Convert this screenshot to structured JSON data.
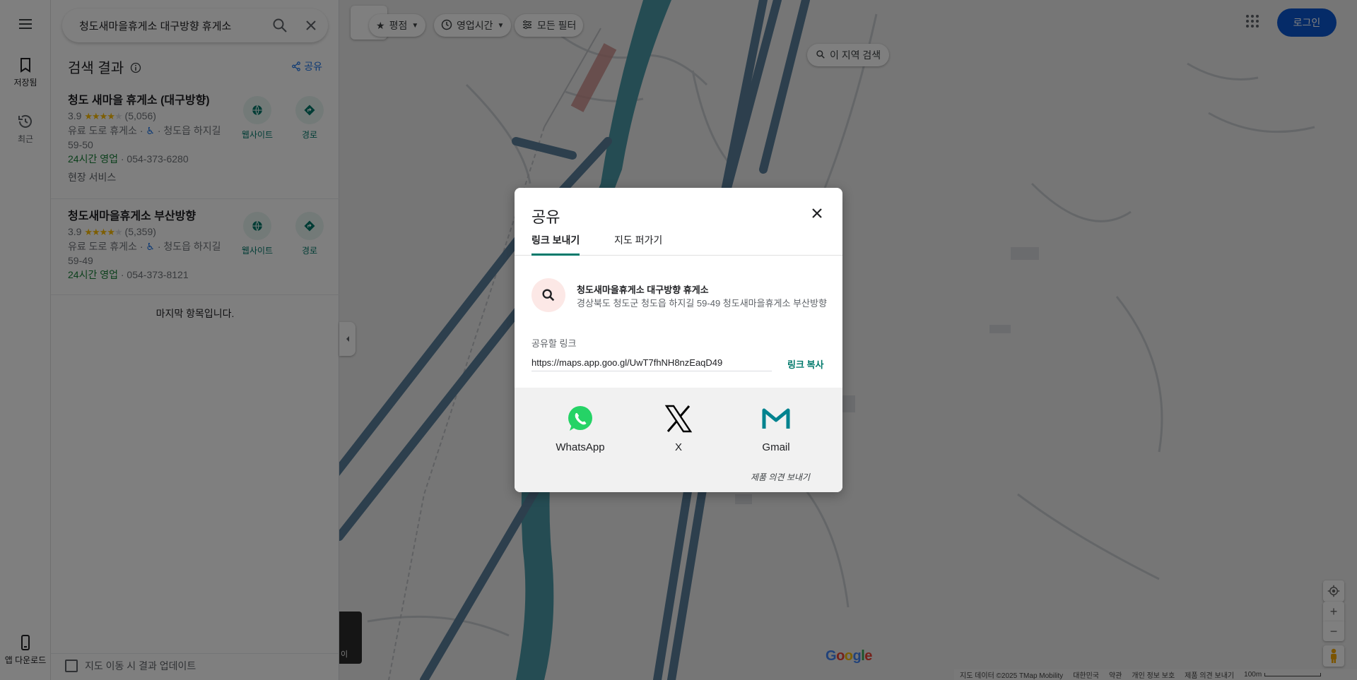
{
  "rail": {
    "saved_label": "저장됨",
    "recent_label": "최근",
    "app_download_label": "앱 다운로드"
  },
  "search": {
    "query": "청도새마을휴게소 대구방향 휴게소"
  },
  "results": {
    "heading": "검색 결과",
    "share_label": "공유",
    "items": [
      {
        "title": "청도 새마을 휴게소 (대구방향)",
        "rating": "3.9",
        "reviews": "(5,056)",
        "category": "유료 도로 휴게소 ·",
        "address_a": "· 청도읍 하지길",
        "address_b": "59-50",
        "hours": "24시간 영업",
        "phone": "· 054-373-6280",
        "extra": "현장 서비스",
        "website_label": "웹사이트",
        "directions_label": "경로"
      },
      {
        "title": "청도새마을휴게소 부산방향",
        "rating": "3.9",
        "reviews": "(5,359)",
        "category": "유료 도로 휴게소 ·",
        "address_a": "· 청도읍 하지길",
        "address_b": "59-49",
        "hours": "24시간 영업",
        "phone": "· 054-373-8121",
        "website_label": "웹사이트",
        "directions_label": "경로"
      }
    ],
    "end_note": "마지막 항목입니다.",
    "update_on_move": "지도 이동 시 결과 업데이트"
  },
  "map": {
    "chips": {
      "rating": "평점",
      "hours": "영업시간",
      "all_filters": "모든 필터"
    },
    "area_search": "이 지역 검색",
    "login": "로그인",
    "thumb_text": "이",
    "logo": "Google",
    "footer": {
      "data": "지도 데이터 ©2025 TMap Mobility",
      "country": "대한민국",
      "terms": "약관",
      "privacy": "개인 정보 보호",
      "feedback": "제품 의견 보내기",
      "scale": "100m"
    }
  },
  "dialog": {
    "title": "공유",
    "tabs": [
      "링크 보내기",
      "지도 퍼가기"
    ],
    "place_name": "청도새마을휴게소 대구방향 휴게소",
    "place_address": "경상북도 청도군 청도읍 하지길 59-49 청도새마을휴게소 부산방향",
    "link_label": "공유할 링크",
    "link_value": "https://maps.app.goo.gl/UwT7fhNH8nzEaqD49",
    "copy_label": "링크 복사",
    "services": [
      "WhatsApp",
      "X",
      "Gmail"
    ],
    "feedback": "제품 의견 보내기"
  },
  "colors": {
    "accent_teal": "#00796b",
    "login_blue": "#0b57d0",
    "open_green": "#188038",
    "star": "#fbbc04",
    "whatsapp": "#25d366",
    "gmail": "#00838f",
    "river": "#4a98a6",
    "road": "#5a7f9b"
  }
}
